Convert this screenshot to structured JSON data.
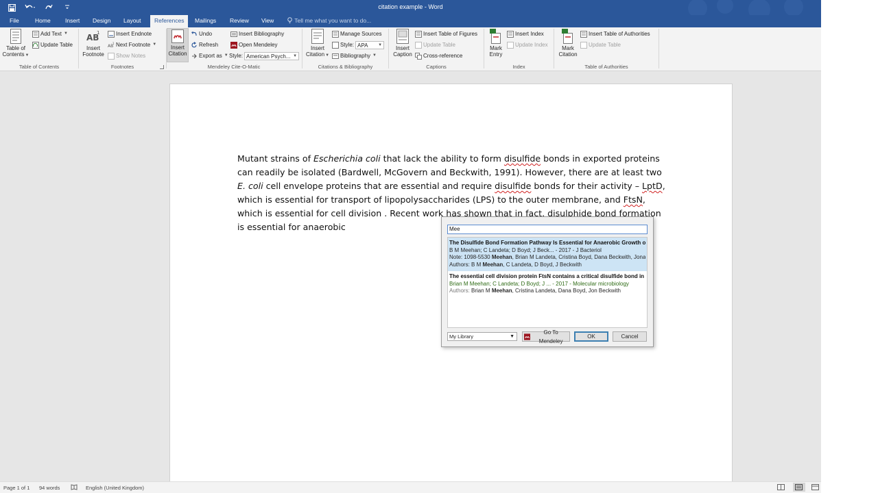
{
  "window": {
    "title": "citation example - Word"
  },
  "tabs": [
    "File",
    "Home",
    "Insert",
    "Design",
    "Layout",
    "References",
    "Mailings",
    "Review",
    "View"
  ],
  "active_tab": "References",
  "tell_me": "Tell me what you want to do...",
  "ribbon": {
    "toc": {
      "table_of_contents_1": "Table of",
      "table_of_contents_2": "Contents",
      "add_text": "Add Text",
      "update_table": "Update Table",
      "label": "Table of Contents"
    },
    "footnotes": {
      "insert_footnote_1": "Insert",
      "insert_footnote_2": "Footnote",
      "insert_endnote": "Insert Endnote",
      "next_footnote": "Next Footnote",
      "show_notes": "Show Notes",
      "label": "Footnotes"
    },
    "mendeley": {
      "insert_citation_1": "Insert",
      "insert_citation_2": "Citation",
      "undo": "Undo",
      "refresh": "Refresh",
      "export_as": "Export as",
      "insert_bibliography": "Insert Bibliography",
      "open_mendeley": "Open Mendeley",
      "style_label": "Style:",
      "style_value": "American Psych...",
      "label": "Mendeley Cite-O-Matic"
    },
    "citations": {
      "insert_citation_1": "Insert",
      "insert_citation_2": "Citation",
      "manage_sources": "Manage Sources",
      "style_label": "Style:",
      "style_value": "APA",
      "bibliography": "Bibliography",
      "label": "Citations & Bibliography"
    },
    "captions": {
      "insert_caption_1": "Insert",
      "insert_caption_2": "Caption",
      "insert_table_of_figures": "Insert Table of Figures",
      "update_table": "Update Table",
      "cross_reference": "Cross-reference",
      "label": "Captions"
    },
    "index": {
      "mark_entry_1": "Mark",
      "mark_entry_2": "Entry",
      "insert_index": "Insert Index",
      "update_index": "Update Index",
      "label": "Index"
    },
    "authorities": {
      "mark_citation_1": "Mark",
      "mark_citation_2": "Citation",
      "insert_table_of_authorities": "Insert Table of Authorities",
      "update_table": "Update Table",
      "label": "Table of Authorities"
    }
  },
  "document": {
    "t1": "Mutant strains of ",
    "t2": "Escherichia coli",
    "t3": " that lack the ability to form ",
    "t4": "disulfide",
    "t5": " bonds in exported proteins can readily be isolated (Bardwell, McGovern and Beckwith, 1991). However, there are at least two ",
    "t6": "E. coli",
    "t7": " cell envelope proteins that are essential and require ",
    "t8": "disulfide",
    "t9": " bonds for their activity – ",
    "t10": "LptD",
    "t11": ", which is essential for transport of lipopolysaccharides (LPS) to the outer membrane, and ",
    "t12": "FtsN",
    "t13": ", which is essential for cell division . Recent work has shown that in fact, disulphide bond formation is essential for anaerobic"
  },
  "dialog": {
    "search_value": "Mee",
    "results": [
      {
        "title": "The Disulfide Bond Formation Pathway Is Essential for Anaerobic Growth of",
        "line2": "B M Meehan; C Landeta; D Boyd; J Beck... - 2017 - J Bacteriol",
        "note_prefix": "Note: 1098-5530 ",
        "note_bold": "Meehan",
        "note_rest": ", Brian M Landeta, Cristina Boyd, Dana Beckwith, Jona",
        "authors_label": "Authors: ",
        "authors_pre": "B M ",
        "authors_bold": "Meehan",
        "authors_rest": ", C Landeta, D Boyd, J Beckwith"
      },
      {
        "title": "The essential cell division protein FtsN contains a critical disulfide bond in a",
        "line2": "Brian M Meehan; C Landeta; D Boyd; J ... - 2017 - Molecular microbiology",
        "authors_label": "Authors: ",
        "authors_pre": "Brian M ",
        "authors_bold": "Meehan",
        "authors_rest": ", Cristina Landeta, Dana Boyd, Jon Beckwith"
      }
    ],
    "library": "My Library",
    "go_to_mendeley": "Go To Mendeley",
    "ok": "OK",
    "cancel": "Cancel"
  },
  "status": {
    "page": "Page 1 of 1",
    "words": "94 words",
    "language": "English (United Kingdom)"
  },
  "colors": {
    "accent": "#2b579a",
    "selection": "#cde4f5"
  }
}
